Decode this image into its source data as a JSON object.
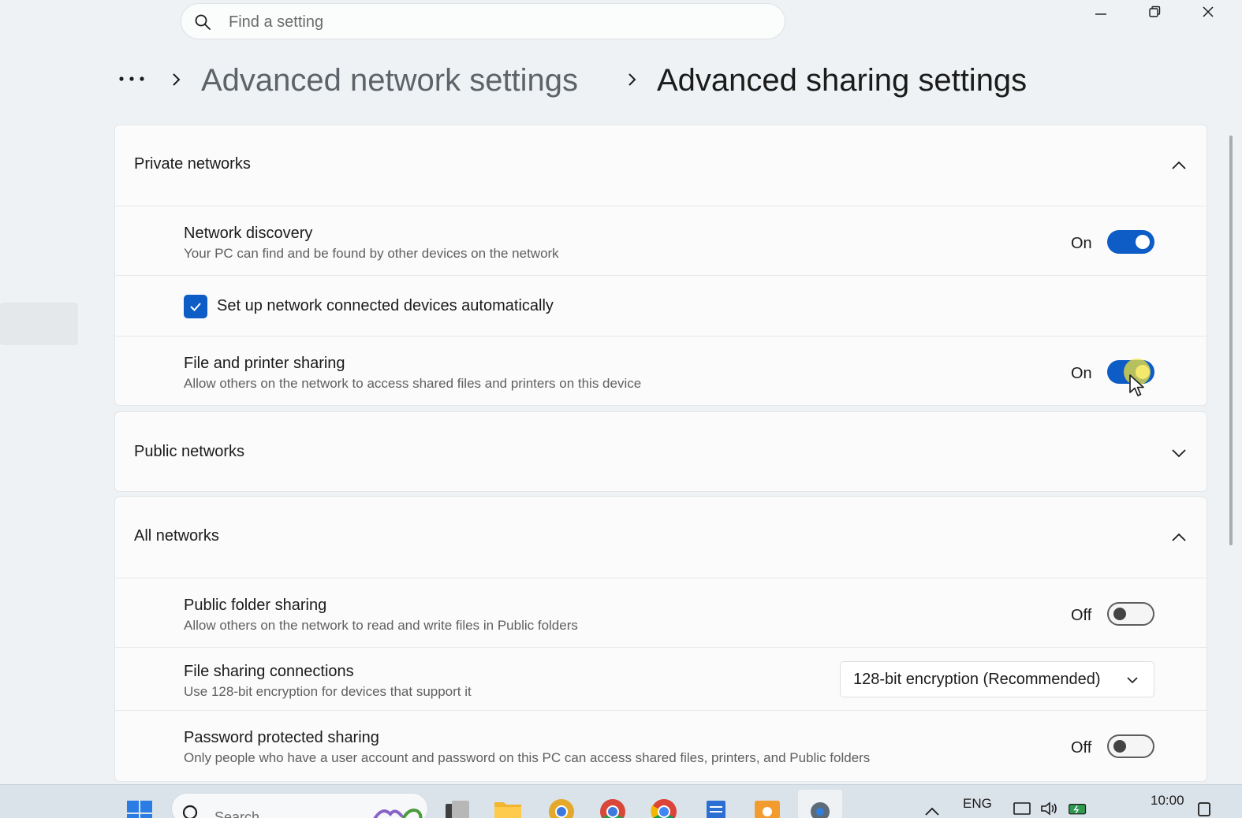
{
  "search": {
    "placeholder": "Find a setting"
  },
  "breadcrumb": {
    "parent": "Advanced network settings",
    "current": "Advanced sharing settings"
  },
  "sections": {
    "private": {
      "title": "Private networks",
      "expanded": true,
      "network_discovery": {
        "label": "Network discovery",
        "description": "Your PC can find and be found by other devices on the network",
        "state": "On"
      },
      "auto_setup": {
        "label": "Set up network connected devices automatically",
        "checked": true
      },
      "file_printer": {
        "label": "File and printer sharing",
        "description": "Allow others on the network to access shared files and printers on this device",
        "state": "On"
      }
    },
    "public": {
      "title": "Public networks",
      "expanded": false
    },
    "all": {
      "title": "All networks",
      "expanded": true,
      "public_folder": {
        "label": "Public folder sharing",
        "description": "Allow others on the network to read and write files in Public folders",
        "state": "Off"
      },
      "file_connections": {
        "label": "File sharing connections",
        "description": "Use 128-bit encryption for devices that support it",
        "selected": "128-bit encryption (Recommended)"
      },
      "password_protected": {
        "label": "Password protected sharing",
        "description": "Only people who have a user account and password on this PC can access shared files, printers, and Public folders",
        "state": "Off"
      }
    }
  },
  "taskbar": {
    "search_label": "Search",
    "language": "ENG",
    "time": "10:00"
  },
  "colors": {
    "accent": "#0e5cc5",
    "background": "#eef2f4",
    "card": "#fbfbfb"
  }
}
